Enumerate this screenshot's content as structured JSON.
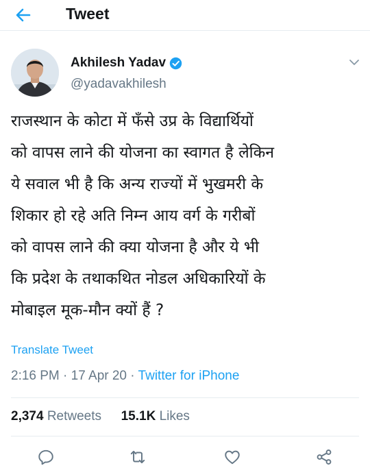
{
  "header": {
    "title": "Tweet",
    "back_icon": "arrow-left-icon",
    "accent_color": "#1da1f2"
  },
  "tweet": {
    "author": {
      "display_name": "Akhilesh Yadav",
      "handle": "@yadavakhilesh",
      "verified": true,
      "verified_icon": "verified-badge-icon"
    },
    "text_lines": [
      "राजस्थान के कोटा में फँसे उप्र के विद्यार्थियों",
      "को वापस लाने की योजना का स्वागत है लेकिन",
      "ये सवाल भी है कि अन्य राज्यों में भुखमरी के",
      "शिकार हो रहे अति निम्न आय वर्ग के गरीबों",
      "को वापस लाने की क्या योजना है और ये भी",
      "कि प्रदेश के तथाकथित नोडल अधिकारियों के",
      "मोबाइल मूक-मौन क्यों हैं ?"
    ],
    "translate_label": "Translate Tweet",
    "time": "2:16 PM",
    "date": "17 Apr 20",
    "separator": "·",
    "source": "Twitter for iPhone",
    "stats": {
      "retweets_count": "2,374",
      "retweets_label": "Retweets",
      "likes_count": "15.1K",
      "likes_label": "Likes"
    }
  },
  "actions": [
    {
      "name": "reply",
      "icon": "reply-icon"
    },
    {
      "name": "retweet",
      "icon": "retweet-icon"
    },
    {
      "name": "like",
      "icon": "heart-icon"
    },
    {
      "name": "share",
      "icon": "share-icon"
    }
  ],
  "colors": {
    "text_primary": "#14171a",
    "text_secondary": "#657786",
    "link": "#1da1f2",
    "divider": "#e6ecf0"
  }
}
